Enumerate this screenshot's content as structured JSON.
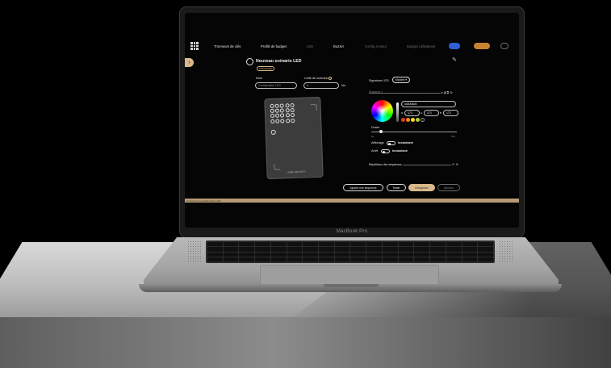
{
  "device": {
    "brand_label": "MacBook Pro"
  },
  "nav": {
    "items": [
      {
        "label": "Tronneurs de clés",
        "state": "active"
      },
      {
        "label": "Profils de badges",
        "state": "active"
      },
      {
        "label": "LED",
        "state": "dim"
      },
      {
        "label": "Buzzer",
        "state": "active"
      },
      {
        "label": "Config. lecteur",
        "state": "dim"
      },
      {
        "label": "Badges utilisateurs",
        "state": "dim"
      }
    ]
  },
  "header": {
    "title": "Nouveau scénario LED",
    "badge": "STANDARD"
  },
  "form": {
    "name_label": "Nom",
    "name_placeholder": "Configuration LED",
    "unit_label": "Unité de scénario",
    "unit_value": "1",
    "unit_suffix": "fois",
    "signature_label": "Signature LED",
    "signature_value": "Marche ▾",
    "sequence_label": "Séquence 1",
    "hex_value": "#ABABAB",
    "rgb": {
      "r": "173",
      "g": "173",
      "b": "173"
    },
    "duration_label": "Durée",
    "duration_min": "0s",
    "duration_max": "10s",
    "display_label": "Affichage",
    "display_value": "Instantané",
    "stop_label": "Arrêt",
    "stop_value": "Instantané",
    "repeat_label": "Répétitions des séquences"
  },
  "reader": {
    "brand": "LABEL SECURITY"
  },
  "swatches": [
    "#e53935",
    "#fb8c00",
    "#fdd835",
    "#c0ca33",
    "#9e9e9e"
  ],
  "actions": {
    "add_sequence": "Ajouter une séquence",
    "test": "Tester",
    "save": "Enregistrer",
    "cancel": "Annuler"
  },
  "status": {
    "text": "Connexion au gestionnaire LED"
  }
}
